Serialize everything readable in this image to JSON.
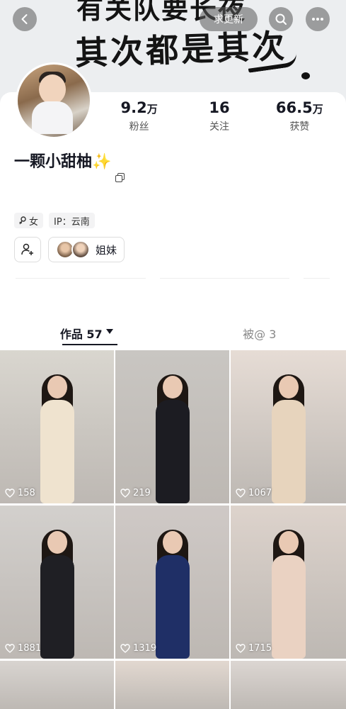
{
  "banner": {
    "line1": "有关队要长夜",
    "line2": "其次都是其次",
    "update_label": "求更新"
  },
  "profile": {
    "nickname": "一颗小甜柚✨",
    "stats": [
      {
        "num": "9.2",
        "unit": "万",
        "label": "粉丝"
      },
      {
        "num": "16",
        "unit": "",
        "label": "关注"
      },
      {
        "num": "66.5",
        "unit": "万",
        "label": "获赞"
      }
    ],
    "tags": {
      "gender": "女",
      "ip": "IP：云南"
    },
    "group_label": "姐妹"
  },
  "tabs": {
    "works": "作品 57",
    "mentions": "被@ 3"
  },
  "videos": [
    {
      "likes": "158",
      "bg": "#d9d6cf",
      "outfit": "#efe3cf"
    },
    {
      "likes": "219",
      "bg": "#c9c6c2",
      "outfit": "#1c1c22"
    },
    {
      "likes": "1067",
      "bg": "#e6dcd5",
      "outfit": "#e7d4bd"
    },
    {
      "likes": "1881",
      "bg": "#d3d0cd",
      "outfit": "#1f1f24"
    },
    {
      "likes": "1319",
      "bg": "#cfc9c6",
      "outfit": "#1f2f66"
    },
    {
      "likes": "1715",
      "bg": "#ddd3cc",
      "outfit": "#ead2c2"
    },
    {
      "likes": "",
      "bg": "#d8d4d0",
      "outfit": "#d8d4d0"
    },
    {
      "likes": "",
      "bg": "#e2d8d0",
      "outfit": "#e2d8d0"
    },
    {
      "likes": "",
      "bg": "#dcd6d2",
      "outfit": "#dcd6d2"
    }
  ]
}
